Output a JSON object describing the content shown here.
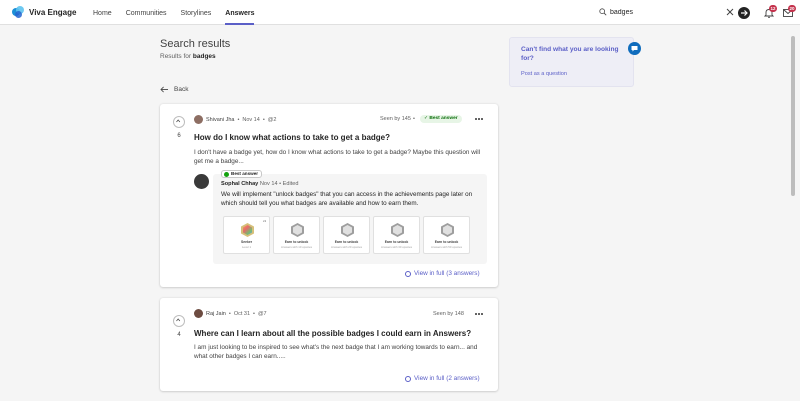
{
  "app": {
    "brand_name": "Viva Engage",
    "nav": [
      "Home",
      "Communities",
      "Storylines",
      "Answers"
    ],
    "active_nav": "Answers"
  },
  "search": {
    "value": "badges",
    "placeholder": ""
  },
  "notifications": {
    "bell_count": "12",
    "mail_count": "20"
  },
  "page": {
    "title": "Search results",
    "results_for_prefix": "Results for",
    "query": "badges",
    "back_label": "Back"
  },
  "side_panel": {
    "title": "Can't find what you are looking for?",
    "link": "Post as a question"
  },
  "results": [
    {
      "author": "Shivani Jha",
      "date": "Nov 14",
      "mentions": "@2",
      "seen": "Seen by 145",
      "best_answer_label": "Best answer",
      "votes": "6",
      "title": "How do I know what actions to take to get a badge?",
      "body": "I don't have a badge yet, how do I know what actions to take to get a badge? Maybe this question will get me a badge...",
      "answer": {
        "tag": "Best answer",
        "author": "Sophal Chhay",
        "date": "Nov 14",
        "edited": "Edited",
        "text": "We will implement \"unlock badges\" that you can access in the achievements page later on which should tell you what badges are available and how to earn them."
      },
      "badges": [
        {
          "label": "Seeker",
          "sub": "Level 1",
          "corner": "x3"
        },
        {
          "label": "Earn to unlock",
          "sub": "Answers with 10 upvotes",
          "corner": ""
        },
        {
          "label": "Earn to unlock",
          "sub": "Answers with 20 upvotes",
          "corner": ""
        },
        {
          "label": "Earn to unlock",
          "sub": "Answers with 30 upvotes",
          "corner": ""
        },
        {
          "label": "Earn to unlock",
          "sub": "Answers with 50 upvotes",
          "corner": ""
        }
      ],
      "view_full": "View in full (3 answers)"
    },
    {
      "author": "Raj Jain",
      "date": "Oct 31",
      "mentions": "@7",
      "seen": "Seen by 148",
      "votes": "4",
      "title": "Where can I learn about all the possible badges I could earn in Answers?",
      "body": "I am just looking to be inspired to see what's the next badge that I am working towards to earn... and what other badges I can earn.....",
      "view_full": "View in full (2 answers)"
    }
  ],
  "colors": {
    "accent": "#5b5fc7",
    "best_answer_green": "#0e700e",
    "notification_red": "#c4314b"
  }
}
